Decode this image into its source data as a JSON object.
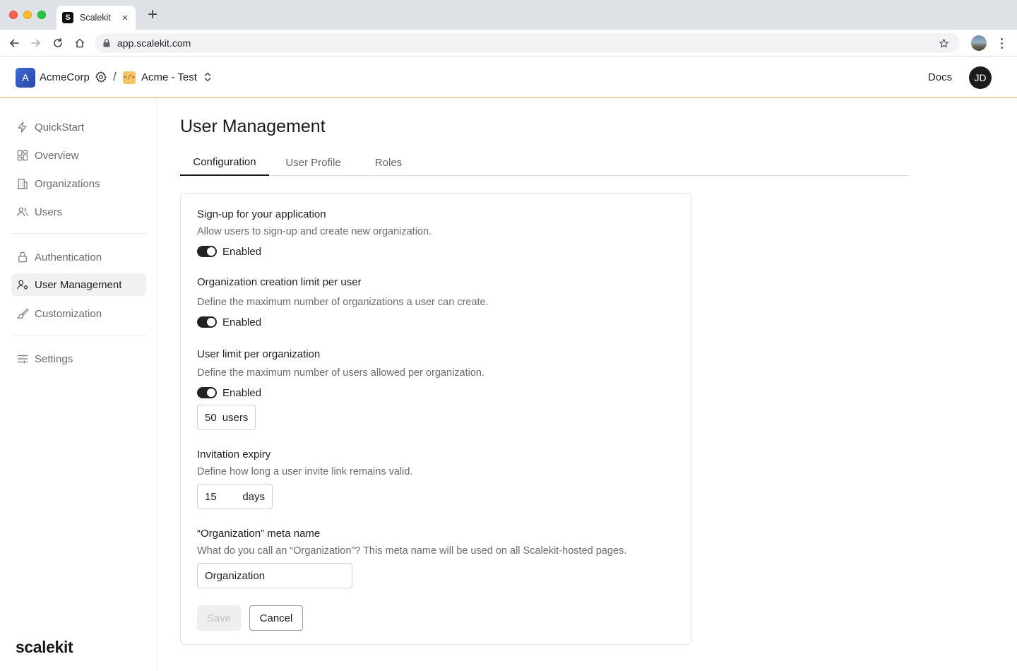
{
  "browser": {
    "tab_title": "Scalekit",
    "tab_close": "×",
    "favicon_letter": "S",
    "new_tab": "+",
    "url": "app.scalekit.com"
  },
  "header": {
    "org_initial": "A",
    "org_name": "AcmeCorp",
    "separator": "/",
    "env_icon_text": "</>",
    "env_name": "Acme - Test",
    "docs_label": "Docs",
    "user_initials": "JD",
    "accent_color": "#f0a944"
  },
  "sidebar": {
    "items": [
      {
        "label": "QuickStart",
        "icon": "bolt-icon"
      },
      {
        "label": "Overview",
        "icon": "dashboard-icon"
      },
      {
        "label": "Organizations",
        "icon": "building-icon"
      },
      {
        "label": "Users",
        "icon": "users-icon"
      },
      {
        "label": "Authentication",
        "icon": "lock-icon"
      },
      {
        "label": "User Management",
        "icon": "user-cog-icon",
        "active": true
      },
      {
        "label": "Customization",
        "icon": "brush-icon"
      },
      {
        "label": "Settings",
        "icon": "sliders-icon"
      }
    ],
    "brand": "scalekit"
  },
  "main": {
    "title": "User Management",
    "tabs": [
      {
        "label": "Configuration",
        "active": true
      },
      {
        "label": "User Profile"
      },
      {
        "label": "Roles"
      }
    ],
    "sections": {
      "signup": {
        "title": "Sign-up for your application",
        "description": "Allow users to sign-up and create new organization.",
        "toggle_label": "Enabled",
        "enabled": true
      },
      "org_limit": {
        "title": "Organization creation limit per user",
        "description": "Define the maximum number of organizations a user can create.",
        "toggle_label": "Enabled",
        "enabled": true
      },
      "user_limit": {
        "title": "User limit per organization",
        "description": "Define the maximum number of users allowed per organization.",
        "toggle_label": "Enabled",
        "enabled": true,
        "value": "50",
        "unit": "users"
      },
      "invite_expiry": {
        "title": "Invitation expiry",
        "description": "Define how long a user invite link remains valid.",
        "value": "15",
        "unit": "days"
      },
      "meta_name": {
        "title": "“Organization” meta name",
        "description": "What do you call an  “Organization”? This meta name will be used on all Scalekit-hosted pages.",
        "value": "Organization"
      }
    },
    "save_label": "Save",
    "cancel_label": "Cancel"
  }
}
